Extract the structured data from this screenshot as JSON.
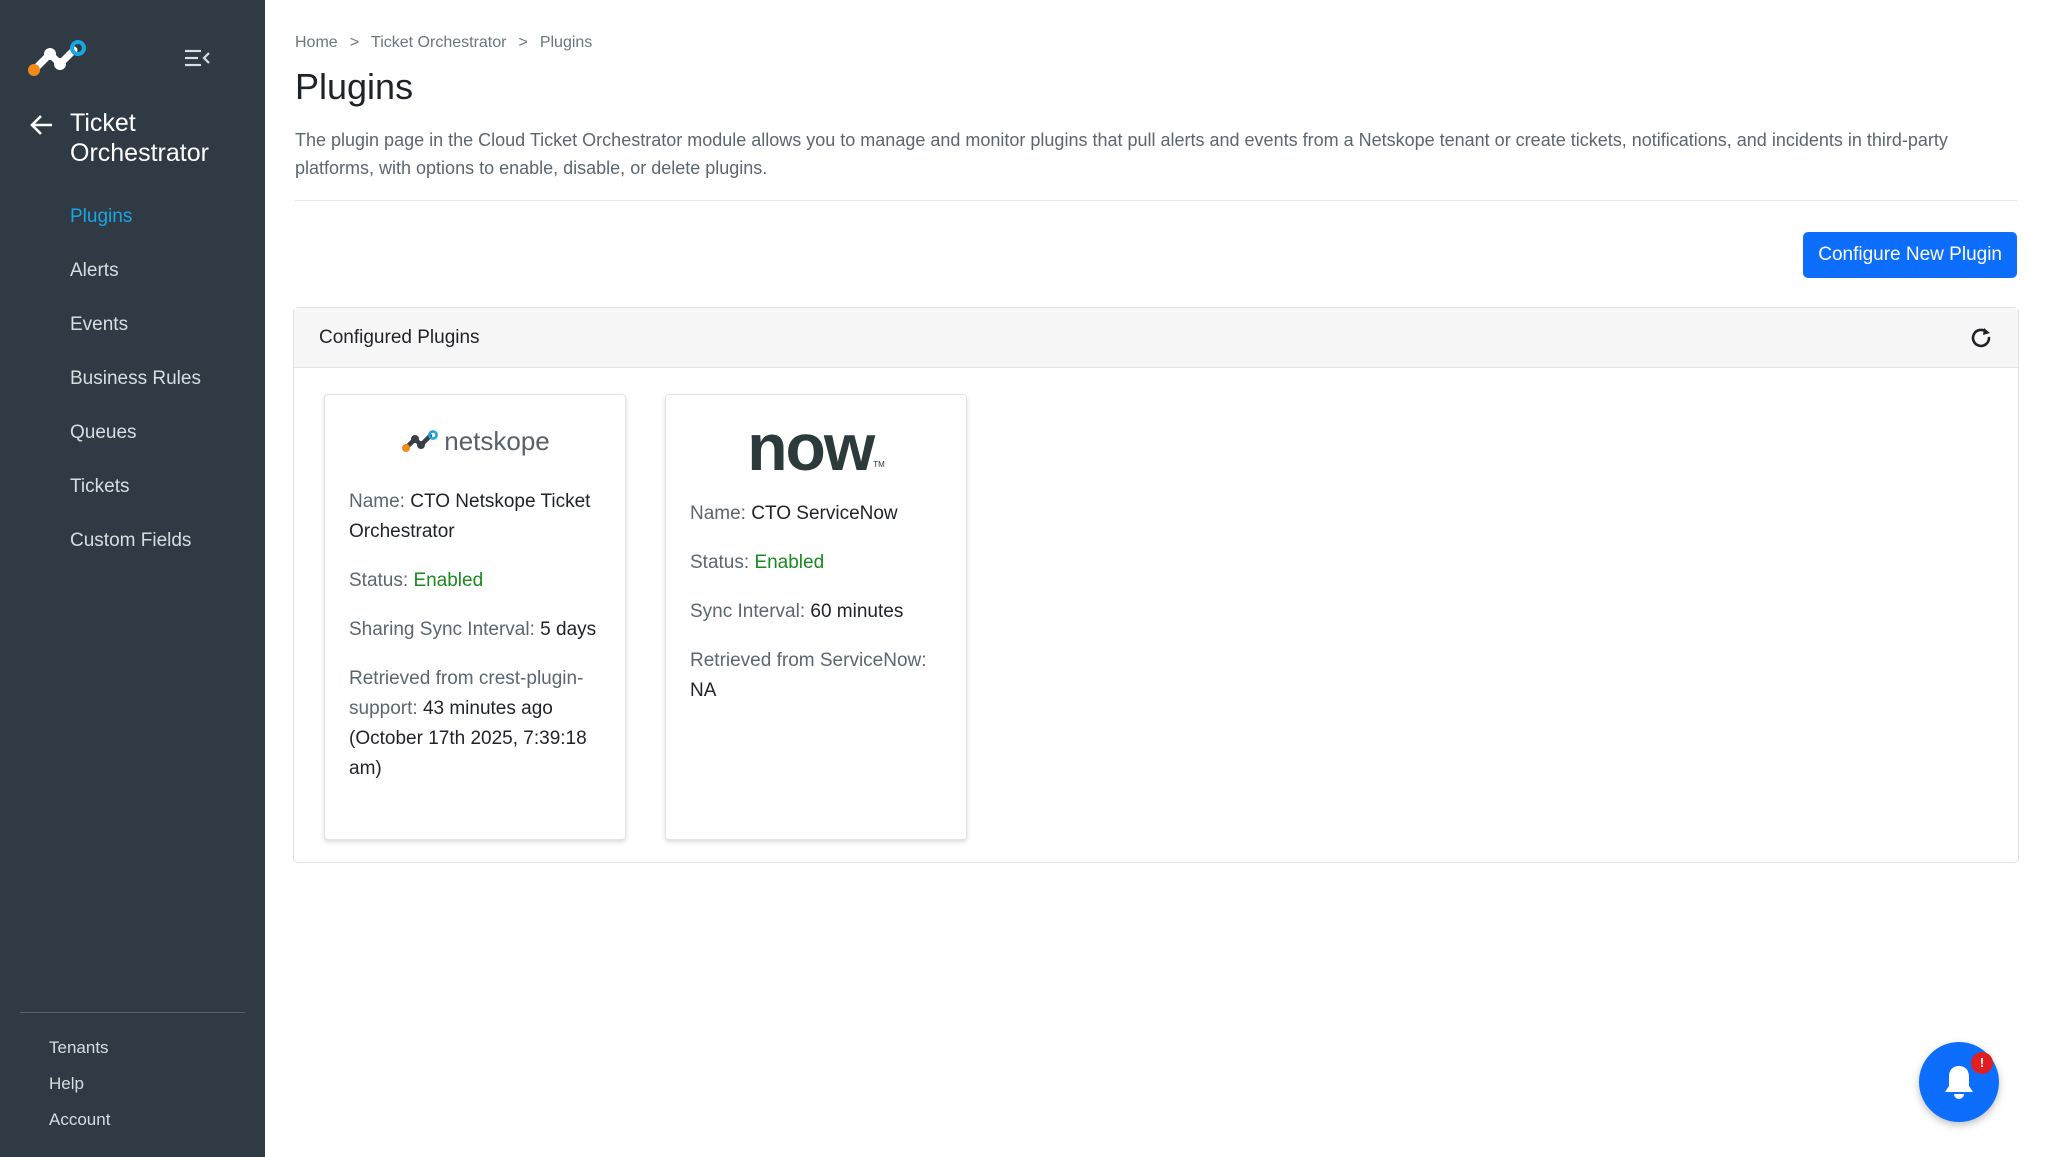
{
  "sidebar": {
    "module_title": "Ticket Orchestrator",
    "nav_items": [
      {
        "label": "Plugins",
        "active": true
      },
      {
        "label": "Alerts",
        "active": false
      },
      {
        "label": "Events",
        "active": false
      },
      {
        "label": "Business Rules",
        "active": false
      },
      {
        "label": "Queues",
        "active": false
      },
      {
        "label": "Tickets",
        "active": false
      },
      {
        "label": "Custom Fields",
        "active": false
      }
    ],
    "bottom_items": [
      {
        "label": "Tenants"
      },
      {
        "label": "Help"
      },
      {
        "label": "Account"
      }
    ]
  },
  "breadcrumb": {
    "items": [
      "Home",
      "Ticket Orchestrator",
      "Plugins"
    ],
    "separator": ">"
  },
  "page": {
    "title": "Plugins",
    "description": "The plugin page in the Cloud Ticket Orchestrator module allows you to manage and monitor plugins that pull alerts and events from a Netskope tenant or create tickets, notifications, and incidents in third-party platforms, with options to enable, disable, or delete plugins.",
    "configure_button": "Configure New Plugin"
  },
  "panel": {
    "title": "Configured Plugins"
  },
  "plugins": [
    {
      "logo_text": "netskope",
      "name_label": "Name:",
      "name": "CTO Netskope Ticket Orchestrator",
      "status_label": "Status:",
      "status": "Enabled",
      "interval_label": "Sharing Sync Interval:",
      "interval": "5 days",
      "retrieved_label": "Retrieved from crest-plugin-support:",
      "retrieved": "43 minutes ago (October 17th 2025, 7:39:18 am)"
    },
    {
      "logo_text": "now",
      "logo_tm": "TM",
      "name_label": "Name:",
      "name": "CTO ServiceNow",
      "status_label": "Status:",
      "status": "Enabled",
      "interval_label": "Sync Interval:",
      "interval": "60 minutes",
      "retrieved_label": "Retrieved from ServiceNow:",
      "retrieved": "NA"
    }
  ],
  "notification": {
    "badge": "!"
  },
  "colors": {
    "sidebar_bg": "#2f3a45",
    "active_nav": "#1aa6e3",
    "primary": "#0d6efd",
    "status_enabled": "#1a8a1f",
    "badge": "#e02020"
  }
}
